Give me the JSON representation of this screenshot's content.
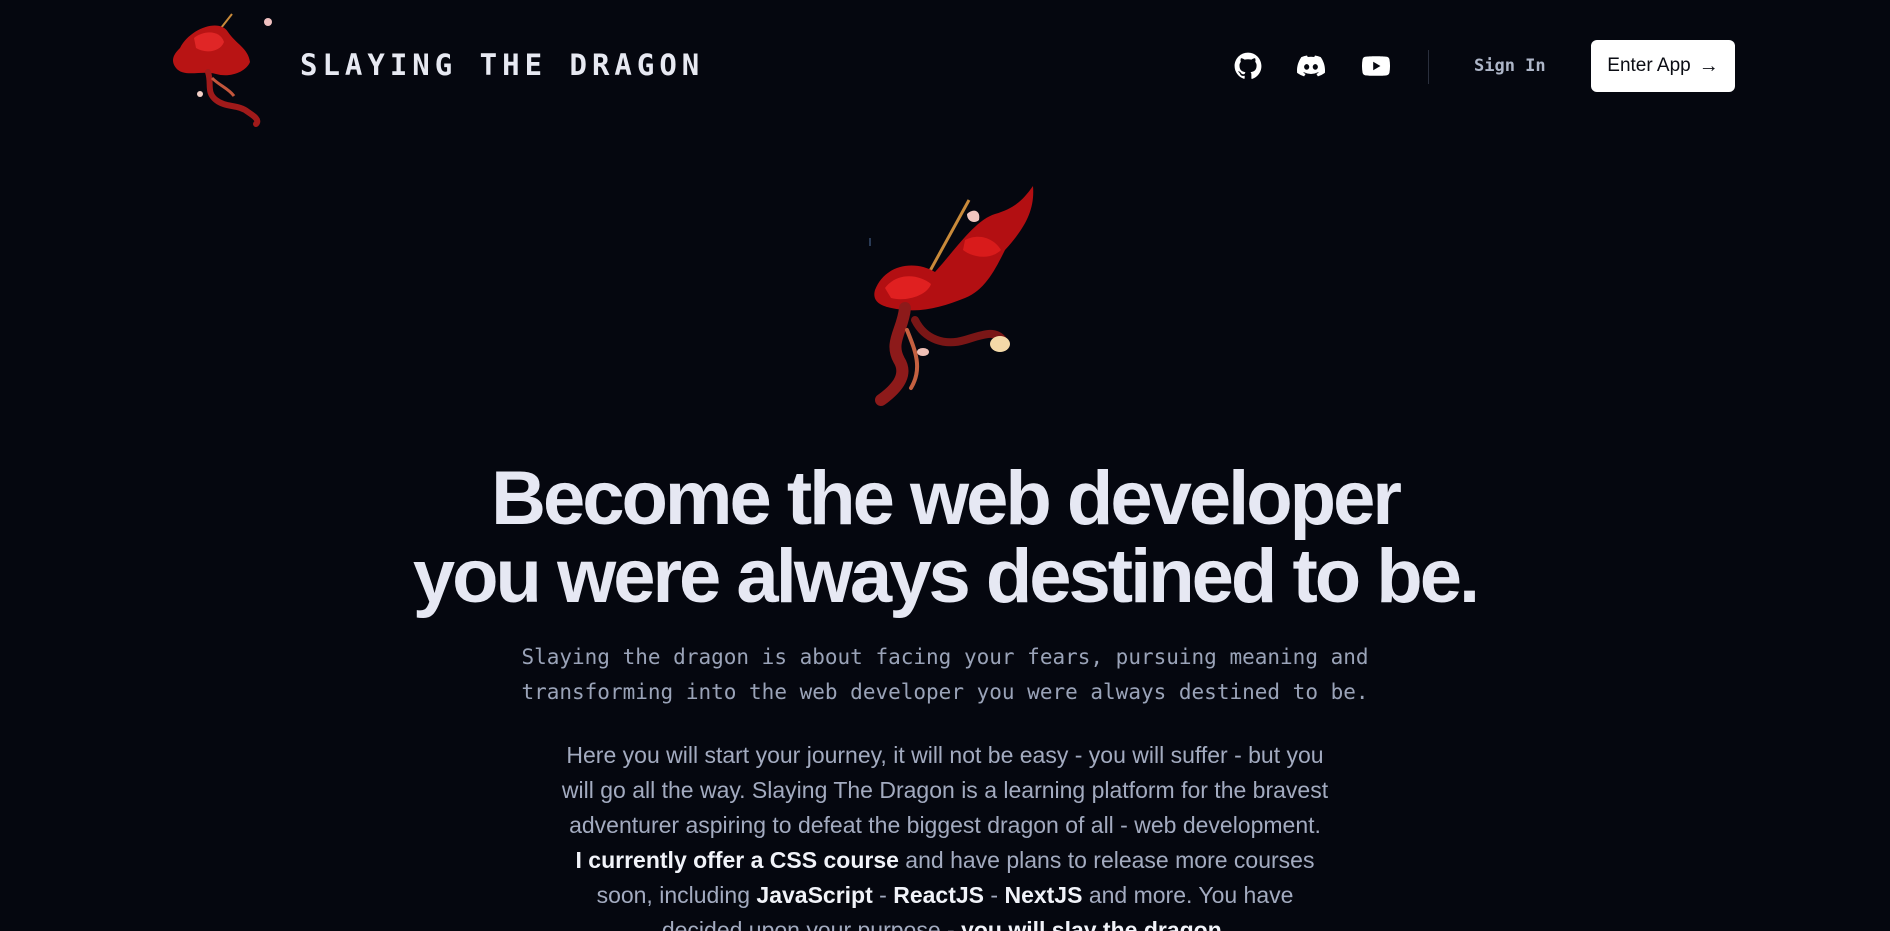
{
  "header": {
    "brand_name": "SLAYING THE DRAGON",
    "logo_icon": "red-knight-logo",
    "nav_icons": [
      "github-icon",
      "discord-icon",
      "youtube-icon"
    ],
    "sign_in_label": "Sign In",
    "enter_app_label": "Enter App",
    "enter_app_arrow": "→"
  },
  "hero": {
    "figure_icon": "red-dragon-slayer-illustration",
    "headline_line1": "Become the web developer",
    "headline_line2": "you were always destined to be.",
    "lead_line1": "Slaying the dragon is about facing your fears, pursuing meaning and",
    "lead_line2": "transforming into the web developer you were always destined to be.",
    "body": {
      "line1": "Here you will start your journey, it will not be easy - you will suffer - but you",
      "line2": "will go all the way. Slaying The Dragon is a learning platform for the bravest",
      "line3": "adventurer aspiring to defeat the biggest dragon of all - web development.",
      "css_course": "I currently offer a CSS course",
      "line4_rest": " and have plans to release more courses",
      "line5_prefix": "soon, including ",
      "js": "JavaScript",
      "sep1": " - ",
      "react": "ReactJS",
      "sep2": " - ",
      "next": "NextJS",
      "line5_suffix": " and more. You have",
      "line6_prefix": "decided upon your purpose - ",
      "slay": "you will slay the dragon."
    }
  },
  "colors": {
    "background": "#05070f",
    "text": "#e6e8f3",
    "muted": "#9aa3b8",
    "accent_red": "#c41a1a",
    "button_bg": "#ffffff"
  }
}
